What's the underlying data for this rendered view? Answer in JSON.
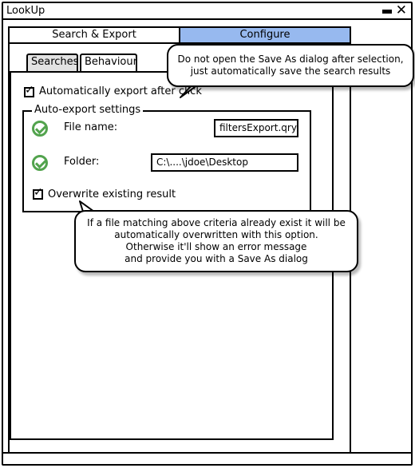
{
  "window": {
    "title": "LookUp",
    "close_glyph": "✕"
  },
  "tabs": [
    {
      "label": "Search & Export",
      "active": true
    },
    {
      "label": "Configure",
      "active": false,
      "color": "#97b9ef"
    }
  ],
  "subtabs": [
    {
      "label": "Searches",
      "active": false
    },
    {
      "label": "Behaviour",
      "active": true
    }
  ],
  "behaviour": {
    "auto_export": {
      "label": "Automatically export after click",
      "checked": true
    },
    "fieldset_legend": "Auto-export settings",
    "file_name": {
      "label": "File name:",
      "value": "filtersExport.qry",
      "status_icon": "check-circle-icon"
    },
    "folder": {
      "label": "Folder:",
      "value": "C:\\....\\jdoe\\Desktop",
      "status_icon": "check-circle-icon"
    },
    "overwrite": {
      "label": "Overwrite existing result",
      "checked": true
    }
  },
  "callouts": {
    "top": [
      "Do not open the Save As dialog after selection,",
      "just automatically save the search results"
    ],
    "bottom": [
      "If a file matching above criteria already exist it will be",
      "automatically overwritten with this option.",
      "Otherwise it'll show an error message",
      "and provide you with a Save As dialog"
    ]
  },
  "colors": {
    "tab_inactive": "#97b9ef",
    "ok_green": "#52a34d"
  }
}
